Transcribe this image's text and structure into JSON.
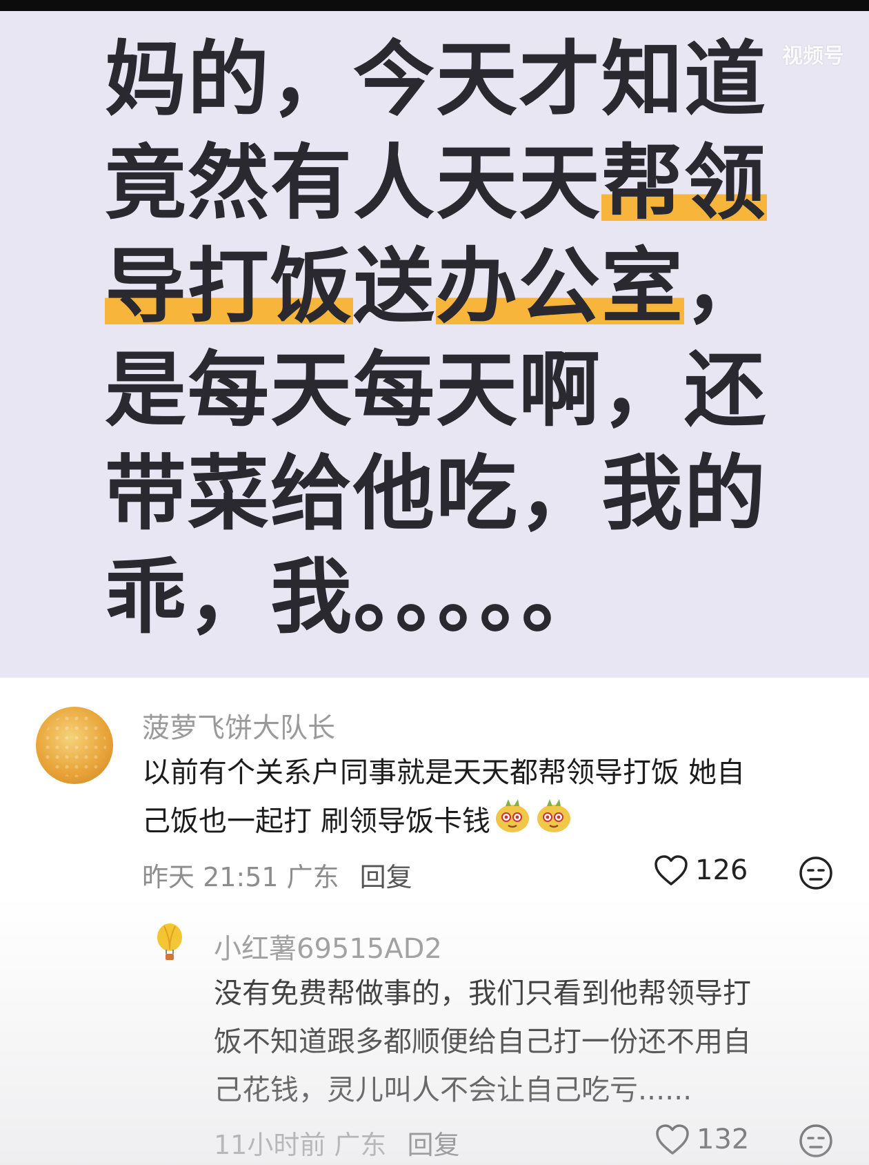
{
  "poster": {
    "watermark": "视频号",
    "watermark_sub": "",
    "lines": [
      {
        "pre": "妈的，今天才知道",
        "hl1": "",
        "mid": "",
        "hl2": "",
        "post": ""
      },
      {
        "pre": "竟然有人天天",
        "hl1": "帮领",
        "mid": "",
        "hl2": "",
        "post": ""
      },
      {
        "pre": "",
        "hl1": "导打饭",
        "mid": "送",
        "hl2": "办公室",
        "post": "，"
      },
      {
        "pre": "是每天每天啊，还",
        "hl1": "",
        "mid": "",
        "hl2": "",
        "post": ""
      },
      {
        "pre": "带菜给他吃，我的",
        "hl1": "",
        "mid": "",
        "hl2": "",
        "post": ""
      },
      {
        "pre": "乖，我。。。。。",
        "hl1": "",
        "mid": "",
        "hl2": "",
        "post": ""
      }
    ]
  },
  "comments": [
    {
      "username": "菠萝飞饼大队长",
      "lines": [
        "以前有个关系户同事就是天天都帮领导打饭 她自",
        "己饭也一起打 刷领导饭卡钱"
      ],
      "time": "昨天 21:51 广东",
      "reply_label": "回复",
      "likes": "126"
    },
    {
      "username": "小红薯69515AD2",
      "lines": [
        "没有免费帮做事的，我们只看到他帮领导打",
        "饭不知道跟多都顺便给自己打一份还不用自",
        "己花钱，灵儿叫人不会让自己吃亏......"
      ],
      "time": "11小时前 广东",
      "reply_label": "回复",
      "likes": "132"
    }
  ],
  "colors": {
    "poster_bg": "#e9e6f4",
    "highlight": "#f7b53c",
    "text_dark": "#2a2930"
  },
  "icons": [
    "heart-icon",
    "dislike-face-icon",
    "sly-face-emoji"
  ]
}
